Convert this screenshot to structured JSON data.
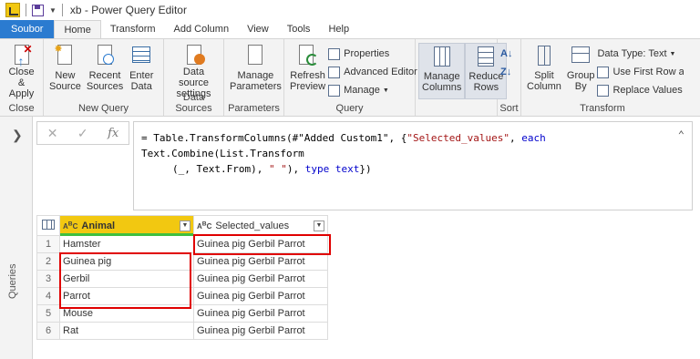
{
  "window": {
    "title": "xb - Power Query Editor"
  },
  "tabs": [
    {
      "label": "Soubor"
    },
    {
      "label": "Home"
    },
    {
      "label": "Transform"
    },
    {
      "label": "Add Column"
    },
    {
      "label": "View"
    },
    {
      "label": "Tools"
    },
    {
      "label": "Help"
    }
  ],
  "ribbon": {
    "close": {
      "close_apply": "Close &\nApply",
      "group": "Close"
    },
    "new_query": {
      "new_source": "New\nSource",
      "recent_sources": "Recent\nSources",
      "enter_data": "Enter\nData",
      "group": "New Query"
    },
    "data_sources": {
      "settings": "Data source\nsettings",
      "group": "Data Sources"
    },
    "parameters": {
      "manage": "Manage\nParameters",
      "group": "Parameters"
    },
    "query": {
      "refresh": "Refresh\nPreview",
      "properties": "Properties",
      "advanced_editor": "Advanced Editor",
      "manage": "Manage",
      "group": "Query"
    },
    "manage_columns": {
      "manage_columns": "Manage\nColumns",
      "reduce_rows": "Reduce\nRows"
    },
    "sort": {
      "group": "Sort"
    },
    "transform": {
      "split_column": "Split\nColumn",
      "group_by": "Group\nBy",
      "data_type": "Data Type: Text",
      "first_row": "Use First Row as H",
      "replace_values": "Replace Values",
      "group": "Transform"
    }
  },
  "queries_pane": {
    "label": "Queries"
  },
  "formula": {
    "line1_a": "= Table.TransformColumns(#\"Added Custom1\", {",
    "line1_str": "\"Selected_values\"",
    "line1_b": ", ",
    "line1_kw": "each",
    "line1_c": " Text.Combine(List.Transform",
    "line2_a": "(_, Text.From), ",
    "line2_str": "\" \"",
    "line2_b": "), ",
    "line2_kw": "type text",
    "line2_c": "})"
  },
  "table": {
    "headers": {
      "animal": "Animal",
      "selected": "Selected_values"
    },
    "rows": [
      {
        "n": "1",
        "animal": "Hamster",
        "selected": "Guinea pig Gerbil Parrot"
      },
      {
        "n": "2",
        "animal": "Guinea pig",
        "selected": "Guinea pig Gerbil Parrot"
      },
      {
        "n": "3",
        "animal": "Gerbil",
        "selected": "Guinea pig Gerbil Parrot"
      },
      {
        "n": "4",
        "animal": "Parrot",
        "selected": "Guinea pig Gerbil Parrot"
      },
      {
        "n": "5",
        "animal": "Mouse",
        "selected": "Guinea pig Gerbil Parrot"
      },
      {
        "n": "6",
        "animal": "Rat",
        "selected": "Guinea pig Gerbil Parrot"
      }
    ]
  },
  "colors": {
    "file_tab": "#2b7bd0",
    "selected_column_header": "#f2c811",
    "highlight": "#e00000"
  }
}
